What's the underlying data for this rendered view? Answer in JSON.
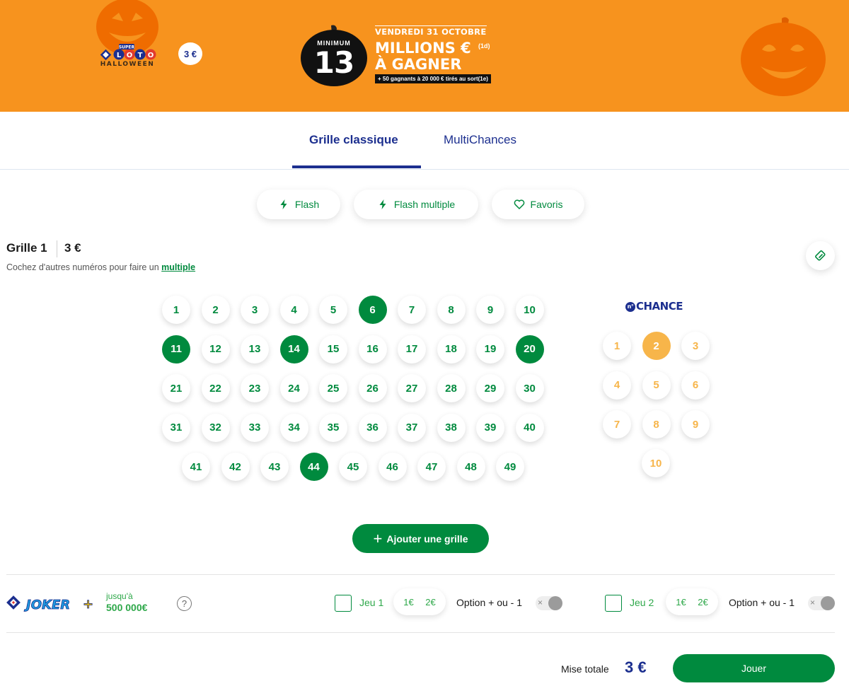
{
  "banner": {
    "logo_text": "LOTO",
    "logo_super": "SUPER",
    "logo_sub": "HALLOWEEN",
    "price": "3 €",
    "promo_minimum": "MINIMUM",
    "promo_amount": "13",
    "promo_date": "VENDREDI 31 OCTOBRE",
    "promo_millions": "MILLIONS €",
    "promo_millions_note": "(1d)",
    "promo_gagner": "À GAGNER",
    "promo_strip": "+ 50 gagnants à 20 000 € tirés au sort(1e)",
    "colors": {
      "orange": "#f7931e",
      "dark_orange": "#ef6c00"
    }
  },
  "tabs": [
    {
      "label": "Grille classique",
      "active": true
    },
    {
      "label": "MultiChances",
      "active": false
    }
  ],
  "quick_actions": {
    "flash": {
      "label": "Flash",
      "icon": "lightning-icon"
    },
    "flash_multiple": {
      "label": "Flash multiple",
      "icon": "lightning-icon"
    },
    "favoris": {
      "label": "Favoris",
      "icon": "heart-icon"
    }
  },
  "grid": {
    "title": "Grille 1",
    "price": "3 €",
    "hint_prefix": "Cochez d'autres numéros pour faire un ",
    "hint_link": "multiple",
    "eraser_icon": "eraser-icon",
    "numbers": [
      "1",
      "2",
      "3",
      "4",
      "5",
      "6",
      "7",
      "8",
      "9",
      "10",
      "11",
      "12",
      "13",
      "14",
      "15",
      "16",
      "17",
      "18",
      "19",
      "20",
      "21",
      "22",
      "23",
      "24",
      "25",
      "26",
      "27",
      "28",
      "29",
      "30",
      "31",
      "32",
      "33",
      "34",
      "35",
      "36",
      "37",
      "38",
      "39",
      "40",
      "41",
      "42",
      "43",
      "44",
      "45",
      "46",
      "47",
      "48",
      "49"
    ],
    "selected_numbers": [
      "6",
      "11",
      "14",
      "20",
      "44"
    ],
    "chance_logo": "CHANCE",
    "chance_logo_badge": "n°",
    "chance_numbers": [
      "1",
      "2",
      "3",
      "4",
      "5",
      "6",
      "7",
      "8",
      "9",
      "10"
    ],
    "selected_chance": [
      "2"
    ],
    "colors": {
      "green": "#008a3e",
      "chance_orange": "#f7b54a",
      "navy": "#1c2f8f"
    }
  },
  "add_grid": {
    "label": "Ajouter une grille",
    "icon": "plus-icon"
  },
  "joker": {
    "logo_text": "JOKER+",
    "upto_label": "jusqu'à",
    "amount": "500 000€",
    "help_icon": "?",
    "games": [
      {
        "label": "Jeu 1",
        "stake_1": "1€",
        "stake_2": "2€",
        "option_label": "Option + ou - 1",
        "toggle_off_symbol": "×"
      },
      {
        "label": "Jeu 2",
        "stake_1": "1€",
        "stake_2": "2€",
        "option_label": "Option + ou - 1",
        "toggle_off_symbol": "×"
      }
    ]
  },
  "footer": {
    "total_label": "Mise totale",
    "total_value": "3 €",
    "play_label": "Jouer"
  }
}
